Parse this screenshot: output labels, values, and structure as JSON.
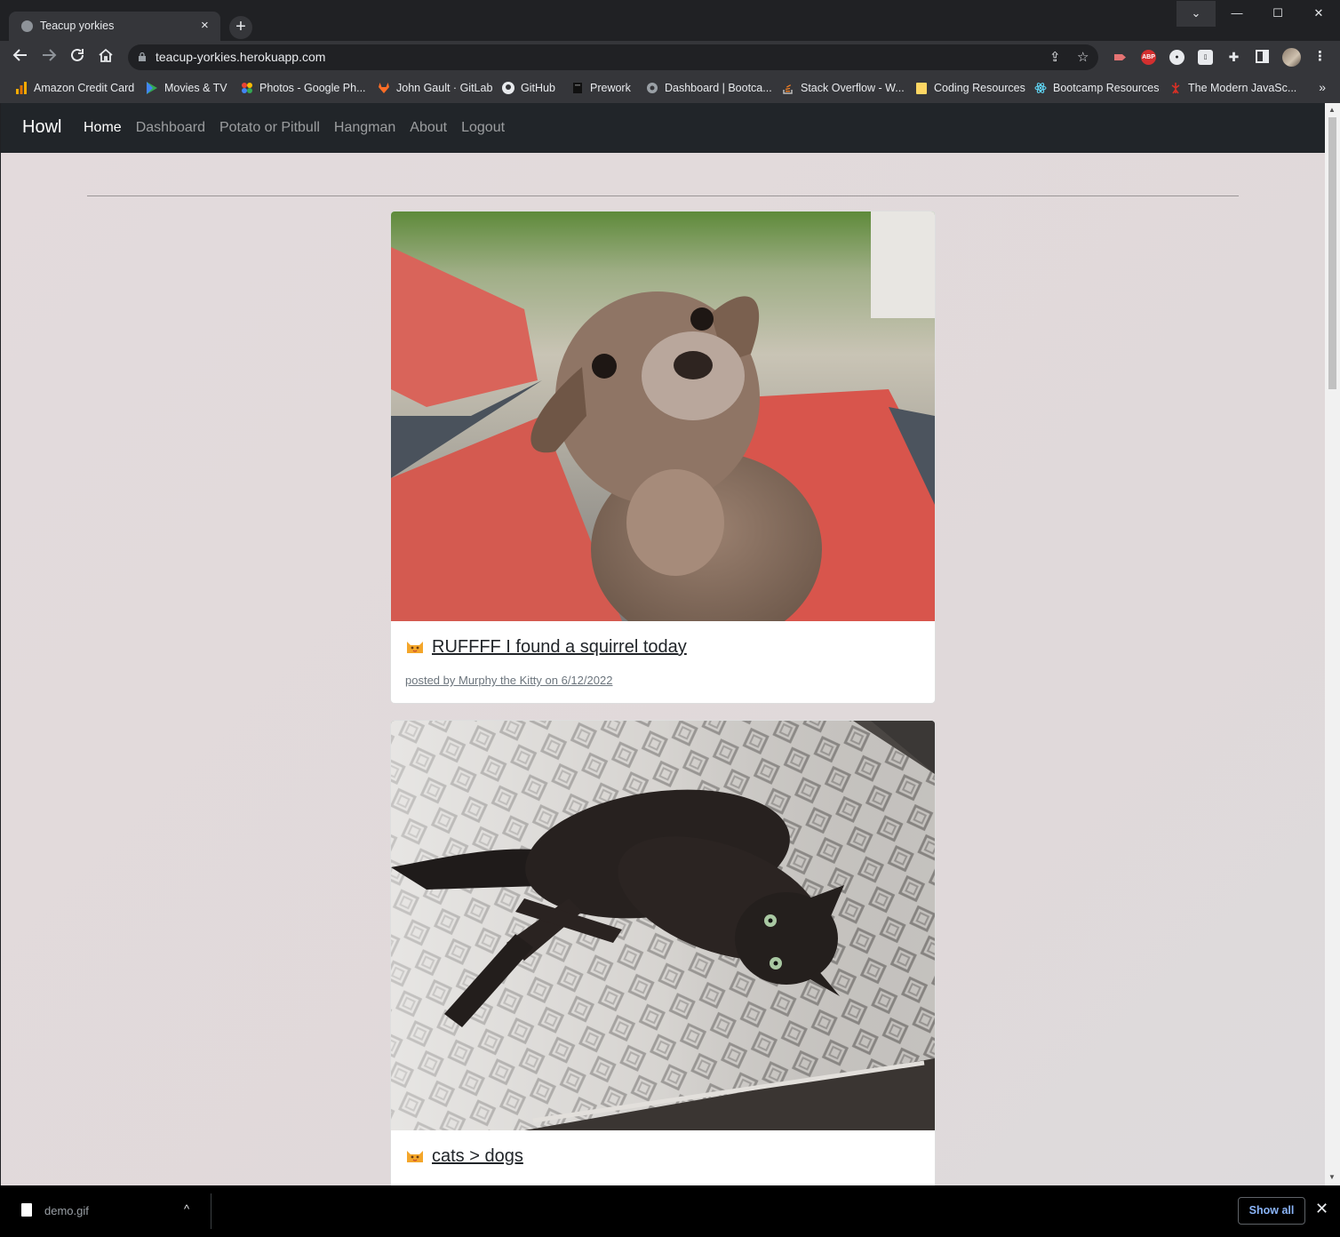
{
  "browser": {
    "tab_title": "Teacup yorkies",
    "tab_close": "×",
    "new_tab": "+",
    "url": "teacup-yorkies.herokuapp.com",
    "window_controls": {
      "tab_search": "⌄",
      "minimize": "—",
      "maximize": "☐",
      "close": "✕"
    },
    "extensions": [
      "video-ext-icon",
      "abp-icon",
      "circle-ext-icon",
      "note-ext-icon",
      "puzzle-icon",
      "sidepanel-icon",
      "avatar",
      "menu-icon"
    ],
    "abp_label": "ABP"
  },
  "bookmarks": [
    {
      "label": "Amazon Credit Card",
      "icon": "amazon-icon",
      "color": "#f0a500"
    },
    {
      "label": "Movies & TV",
      "icon": "play-icon",
      "color": "#34a853"
    },
    {
      "label": "Photos - Google Ph...",
      "icon": "photos-icon",
      "color": "#ea4335"
    },
    {
      "label": "John Gault · GitLab",
      "icon": "gitlab-icon",
      "color": "#e24329"
    },
    {
      "label": "GitHub",
      "icon": "github-icon",
      "color": "#e8eaed"
    },
    {
      "label": "Prework",
      "icon": "book-icon",
      "color": "#202124"
    },
    {
      "label": "Dashboard | Bootca...",
      "icon": "globe-icon",
      "color": "#9aa0a6"
    },
    {
      "label": "Stack Overflow - W...",
      "icon": "stackoverflow-icon",
      "color": "#f48024"
    },
    {
      "label": "Coding Resources",
      "icon": "folder-icon",
      "color": "#fdd663"
    },
    {
      "label": "Bootcamp Resources",
      "icon": "react-icon",
      "color": "#61dafb"
    },
    {
      "label": "The Modern JavaSc...",
      "icon": "js-icon",
      "color": "#d93025"
    }
  ],
  "bookmarks_more": "»",
  "site": {
    "brand": "Howl",
    "nav": [
      "Home",
      "Dashboard",
      "Potato or Pitbull",
      "Hangman",
      "About",
      "Logout"
    ],
    "active_nav": "Home"
  },
  "posts": [
    {
      "title": "RUFFFF I found a squirrel today",
      "meta": "posted by Murphy the Kitty on 6/12/2022",
      "image": "chihuahua-photo"
    },
    {
      "title": "cats > dogs",
      "meta": "",
      "image": "black-cat-photo"
    }
  ],
  "downloads": {
    "file_name": "demo.gif",
    "chevron": "^",
    "show_all": "Show all",
    "close": "✕"
  }
}
